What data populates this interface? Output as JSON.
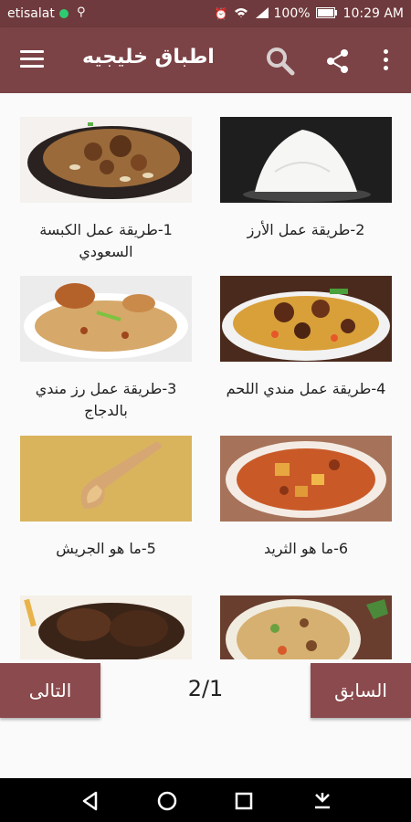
{
  "status_bar": {
    "carrier": "etisalat",
    "battery": "100%",
    "time": "10:29 AM"
  },
  "app_bar": {
    "title": "اطباق خليجيه"
  },
  "recipes": [
    {
      "label": "1-طريقة عمل الكبسة السعودي",
      "image": "kabsa-dish"
    },
    {
      "label": "2-طريقة عمل الأرز",
      "image": "white-rice"
    },
    {
      "label": "3-طريقة عمل رز مندي بالدجاج",
      "image": "mandi-chicken"
    },
    {
      "label": "4-طريقة عمل مندي اللحم",
      "image": "mandi-meat"
    },
    {
      "label": "5-ما هو الجريش",
      "image": "jareesh-grain"
    },
    {
      "label": "6-ما هو الثريد",
      "image": "thareed-stew"
    },
    {
      "label": "",
      "image": "grilled-meat"
    },
    {
      "label": "",
      "image": "rice-plate"
    }
  ],
  "pagination": {
    "next_label": "التالى",
    "prev_label": "السابق",
    "page": "2/1"
  }
}
